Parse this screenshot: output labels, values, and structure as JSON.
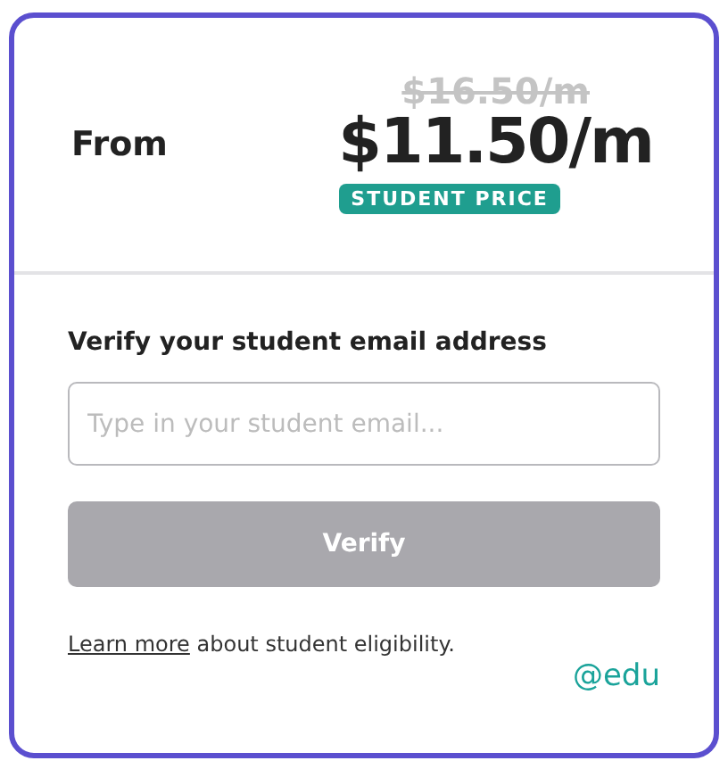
{
  "pricing": {
    "label": "From",
    "old_price": "$16.50/m",
    "price": "$11.50/m",
    "badge": "STUDENT PRICE"
  },
  "verify": {
    "heading": "Verify your student email address",
    "email_field": {
      "placeholder": "Type in your student email..."
    },
    "button": {
      "label": "Verify",
      "disabled": true
    },
    "note": {
      "link": "Learn more",
      "text": "about student eligibility."
    },
    "domain": "@edu"
  }
}
